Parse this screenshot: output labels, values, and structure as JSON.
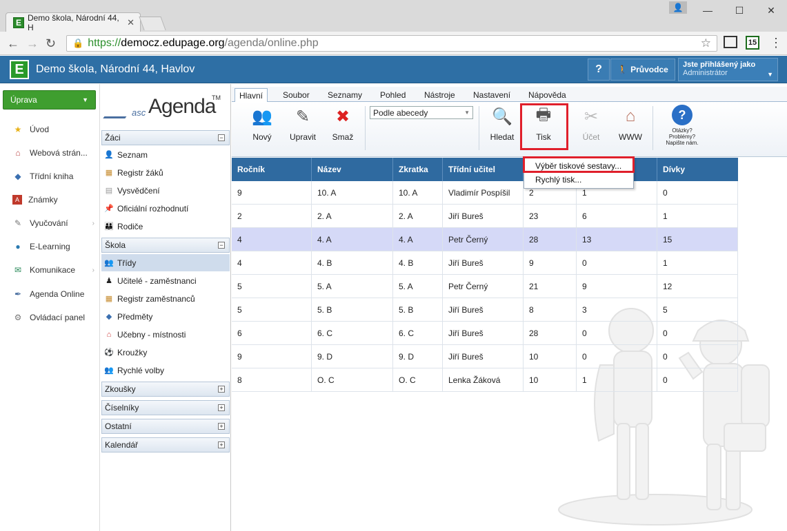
{
  "browser": {
    "tab_title": "Demo škola, Národní 44, H",
    "tab_favicon": "E",
    "url_scheme": "https://",
    "url_host": "democz.edupage.org",
    "url_path": "/agenda/online.php",
    "ext_badge": "15"
  },
  "header": {
    "logo_letter": "E",
    "title": "Demo škola, Národní 44, Havlov",
    "help_label": "?",
    "guide_label": "Průvodce",
    "user_line1": "Jste přihlášený jako",
    "user_line2": "Administrátor"
  },
  "leftnav": {
    "uprava_label": "Úprava",
    "items": [
      {
        "label": "Úvod",
        "icon": "star-icon"
      },
      {
        "label": "Webová strán...",
        "icon": "web-icon"
      },
      {
        "label": "Třídní kniha",
        "icon": "book-icon"
      },
      {
        "label": "Známky",
        "icon": "grades-icon"
      },
      {
        "label": "Vyučování",
        "icon": "teaching-icon"
      },
      {
        "label": "E-Learning",
        "icon": "elearning-icon"
      },
      {
        "label": "Komunikace",
        "icon": "communication-icon"
      },
      {
        "label": "Agenda Online",
        "icon": "agenda-icon"
      },
      {
        "label": "Ovládací panel",
        "icon": "control-panel-icon"
      }
    ]
  },
  "col2": {
    "logo_asc": "asc",
    "logo_agenda": "Agenda",
    "logo_tm": "TM",
    "sections": {
      "zaci": "Žáci",
      "skola": "Škola",
      "zkousky": "Zkoušky",
      "ciselniky": "Číselníky",
      "ostatni": "Ostatní",
      "kalendar": "Kalendář"
    },
    "zaci_items": [
      "Seznam",
      "Registr žáků",
      "Vysvědčení",
      "Oficiální rozhodnutí",
      "Rodiče"
    ],
    "skola_items": [
      "Třídy",
      "Učitelé - zaměstnanci",
      "Registr zaměstnanců",
      "Předměty",
      "Učebny - místnosti",
      "Kroužky",
      "Rychlé volby"
    ]
  },
  "ribbon": {
    "tabs": [
      "Hlavní",
      "Soubor",
      "Seznamy",
      "Pohled",
      "Nástroje",
      "Nastavení",
      "Nápověda"
    ],
    "buttons": {
      "novy": "Nový",
      "upravit": "Upravit",
      "smaz": "Smaž",
      "hledat": "Hledat",
      "tisk": "Tisk",
      "ucet": "Účet",
      "www": "WWW"
    },
    "sort_select": "Podle abecedy",
    "help_q1": "Otázky?",
    "help_q2": "Problémy?",
    "help_q3": "Napište nám."
  },
  "print_menu": {
    "item1": "Výběr tiskové sestavy...",
    "item2": "Rychlý tisk..."
  },
  "table": {
    "columns": [
      "Ročník",
      "Název",
      "Zkratka",
      "Třídní učitel",
      "",
      "",
      "Dívky"
    ],
    "rows": [
      [
        "9",
        "10. A",
        "10. A",
        "Vladimír Pospíšil",
        "2",
        "1",
        "0"
      ],
      [
        "2",
        "2. A",
        "2. A",
        "Jiří Bureš",
        "23",
        "6",
        "1"
      ],
      [
        "4",
        "4. A",
        "4. A",
        "Petr Černý",
        "28",
        "13",
        "15"
      ],
      [
        "4",
        "4. B",
        "4. B",
        "Jiří Bureš",
        "9",
        "0",
        "1"
      ],
      [
        "5",
        "5. A",
        "5. A",
        "Petr Černý",
        "21",
        "9",
        "12"
      ],
      [
        "5",
        "5. B",
        "5. B",
        "Jiří Bureš",
        "8",
        "3",
        "5"
      ],
      [
        "6",
        "6. C",
        "6. C",
        "Jiří Bureš",
        "28",
        "0",
        "0"
      ],
      [
        "9",
        "9. D",
        "9. D",
        "Jiří Bureš",
        "10",
        "0",
        "0"
      ],
      [
        "8",
        "O. C",
        "O. C",
        "Lenka Žáková",
        "10",
        "1",
        "0"
      ]
    ],
    "selected_row": 2
  },
  "colors": {
    "header_bg": "#2e6fa5",
    "accent_green": "#3f9e2f",
    "highlight_red": "#e01f2b",
    "selected_row": "#d5d9f7"
  }
}
